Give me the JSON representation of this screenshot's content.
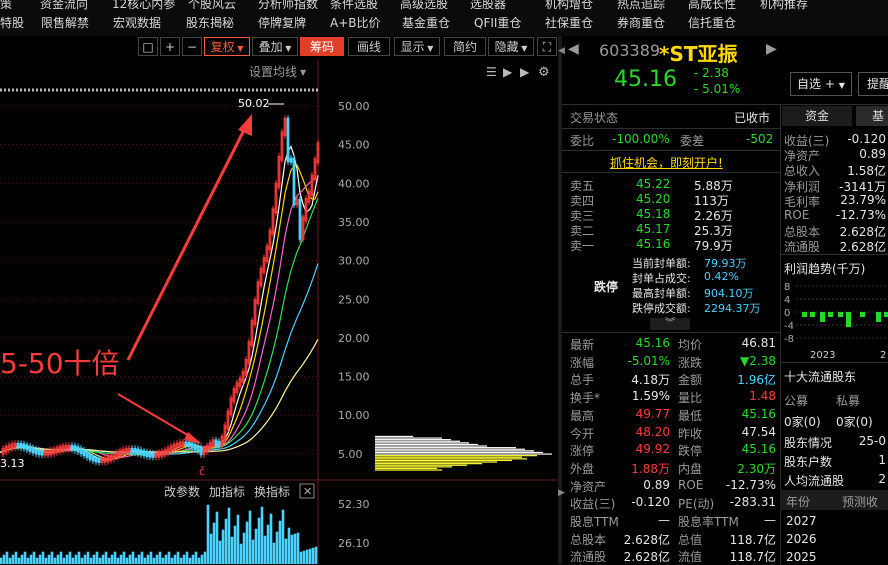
{
  "nav": {
    "row1": [
      "策",
      "资金流向",
      "12核心内参",
      "个股风云",
      "分析师指数",
      "条件选股",
      "高级选股",
      "选股器",
      "机构增仓",
      "热点追踪",
      "高成长性",
      "机构推荐"
    ],
    "row2": [
      "特股",
      "限售解禁",
      "宏观数据",
      "股东揭秘",
      "停牌复牌",
      "A+B比价",
      "基金重仓",
      "QFII重仓",
      "社保重仓",
      "券商重仓",
      "信托重仓"
    ]
  },
  "toolbar": {
    "fuquan": "复权",
    "diejia": "叠加",
    "chouma": "筹码",
    "huaxian": "画线",
    "xianshi": "显示",
    "jianyue": "简约",
    "yincang": "隐藏"
  },
  "chart": {
    "settings_label": "设置均线",
    "peak_label": "50.02",
    "low_label": "3.13",
    "annotation": "5-50十倍",
    "y_ticks": [
      "50.00",
      "45.00",
      "40.00",
      "35.00",
      "30.00",
      "25.00",
      "20.00",
      "15.00",
      "10.00",
      "5.00"
    ],
    "indicator_buttons": [
      "改参数",
      "加指标",
      "换指标"
    ],
    "vol_ticks": [
      "52.30",
      "26.10"
    ],
    "colors": {
      "annotation": "#ff3b3b",
      "ma_yellow": "#fff8a0",
      "ma_cyan": "#4dd2ff",
      "ma_green": "#33dd55",
      "ma_pink": "#ff66cc"
    }
  },
  "quote": {
    "code": "603389",
    "name": "*ST亚振",
    "price": "45.16",
    "change": "- 2.38",
    "change_pct": "- 5.01%",
    "watch_button": "自选",
    "tip_button": "提醒",
    "status_label": "交易状态",
    "status_value": "已收市",
    "weibi_label": "委比",
    "weibi_value": "-100.00%",
    "weicha_label": "委差",
    "weicha_value": "-502",
    "promo": "抓住机会，即刻开户!",
    "asks": [
      {
        "label": "卖五",
        "price": "45.22",
        "vol": "5.88万"
      },
      {
        "label": "卖四",
        "price": "45.20",
        "vol": "113万"
      },
      {
        "label": "卖三",
        "price": "45.18",
        "vol": "2.26万"
      },
      {
        "label": "卖二",
        "price": "45.17",
        "vol": "25.3万"
      },
      {
        "label": "卖一",
        "price": "45.16",
        "vol": "79.9万"
      }
    ],
    "limit_label": "跌停",
    "limit_info": [
      {
        "label": "当前封单额:",
        "value": "79.93万"
      },
      {
        "label": "封单占成交:",
        "value": "0.42%"
      },
      {
        "label": "最高封单额:",
        "value": "904.10万"
      },
      {
        "label": "跌停成交额:",
        "value": "2294.37万"
      }
    ],
    "stats_left": [
      {
        "label": "最新",
        "value": "45.16",
        "color": "#27d927"
      },
      {
        "label": "涨幅",
        "value": "-5.01%",
        "color": "#27d927"
      },
      {
        "label": "总手",
        "value": "4.18万",
        "color": "#e6e6e6"
      },
      {
        "label": "换手*",
        "value": "1.59%",
        "color": "#e6e6e6"
      },
      {
        "label": "最高",
        "value": "49.77",
        "color": "#ff3b3b"
      },
      {
        "label": "今开",
        "value": "48.20",
        "color": "#ff3b3b"
      },
      {
        "label": "涨停",
        "value": "49.92",
        "color": "#ff3b3b"
      },
      {
        "label": "外盘",
        "value": "1.88万",
        "color": "#ff3b3b"
      },
      {
        "label": "净资产",
        "value": "0.89",
        "color": "#e6e6e6"
      },
      {
        "label": "收益(三)",
        "value": "-0.120",
        "color": "#e6e6e6"
      },
      {
        "label": "股息TTM",
        "value": "—",
        "color": "#e6e6e6"
      },
      {
        "label": "总股本",
        "value": "2.628亿",
        "color": "#e6e6e6"
      },
      {
        "label": "流通股",
        "value": "2.628亿",
        "color": "#e6e6e6"
      }
    ],
    "stats_right": [
      {
        "label": "均价",
        "value": "46.81",
        "color": "#e6e6e6"
      },
      {
        "label": "涨跌",
        "value": "▼2.38",
        "color": "#27d927"
      },
      {
        "label": "金额",
        "value": "1.96亿",
        "color": "#4dd2ff"
      },
      {
        "label": "量比",
        "value": "1.48",
        "color": "#ff3b3b"
      },
      {
        "label": "最低",
        "value": "45.16",
        "color": "#27d927"
      },
      {
        "label": "昨收",
        "value": "47.54",
        "color": "#e6e6e6"
      },
      {
        "label": "跌停",
        "value": "45.16",
        "color": "#27d927"
      },
      {
        "label": "内盘",
        "value": "2.30万",
        "color": "#27d927"
      },
      {
        "label": "ROE",
        "value": "-12.73%",
        "color": "#e6e6e6"
      },
      {
        "label": "PE(动)",
        "value": "-283.31",
        "color": "#e6e6e6"
      },
      {
        "label": "股息率TTM",
        "value": "—",
        "color": "#e6e6e6"
      },
      {
        "label": "总值",
        "value": "118.7亿",
        "color": "#e6e6e6"
      },
      {
        "label": "流值",
        "value": "118.7亿",
        "color": "#e6e6e6"
      }
    ]
  },
  "side": {
    "tabs": [
      "资金",
      "基"
    ],
    "fin": [
      {
        "label": "收益(三)",
        "value": "-0.120"
      },
      {
        "label": "净资产",
        "value": "0.89"
      },
      {
        "label": "总收入",
        "value": "1.58亿"
      },
      {
        "label": "净利润",
        "value": "-3141万"
      },
      {
        "label": "毛利率",
        "value": "23.79%"
      },
      {
        "label": "ROE",
        "value": "-12.73%"
      },
      {
        "label": "总股本",
        "value": "2.628亿"
      },
      {
        "label": "流通股",
        "value": "2.628亿"
      }
    ],
    "profit_title": "利润趋势(千万)",
    "profit_ticks": [
      "8",
      "4",
      "0",
      "-4",
      "-8"
    ],
    "profit_year": "2023",
    "profit_year2": "2",
    "holders_title": "十大流通股东",
    "fund_label": "公募",
    "private_label": "私募",
    "fund_value": "0家(0)",
    "private_value": "0家(0)",
    "holder_rows": [
      {
        "label": "股东情况",
        "value": "25-0"
      },
      {
        "label": "股东户数",
        "value": "1"
      },
      {
        "label": "人均流通股",
        "value": "2"
      }
    ],
    "forecast_header": [
      "年份",
      "预测收"
    ],
    "forecast_years": [
      "2027",
      "2026",
      "2025"
    ]
  }
}
